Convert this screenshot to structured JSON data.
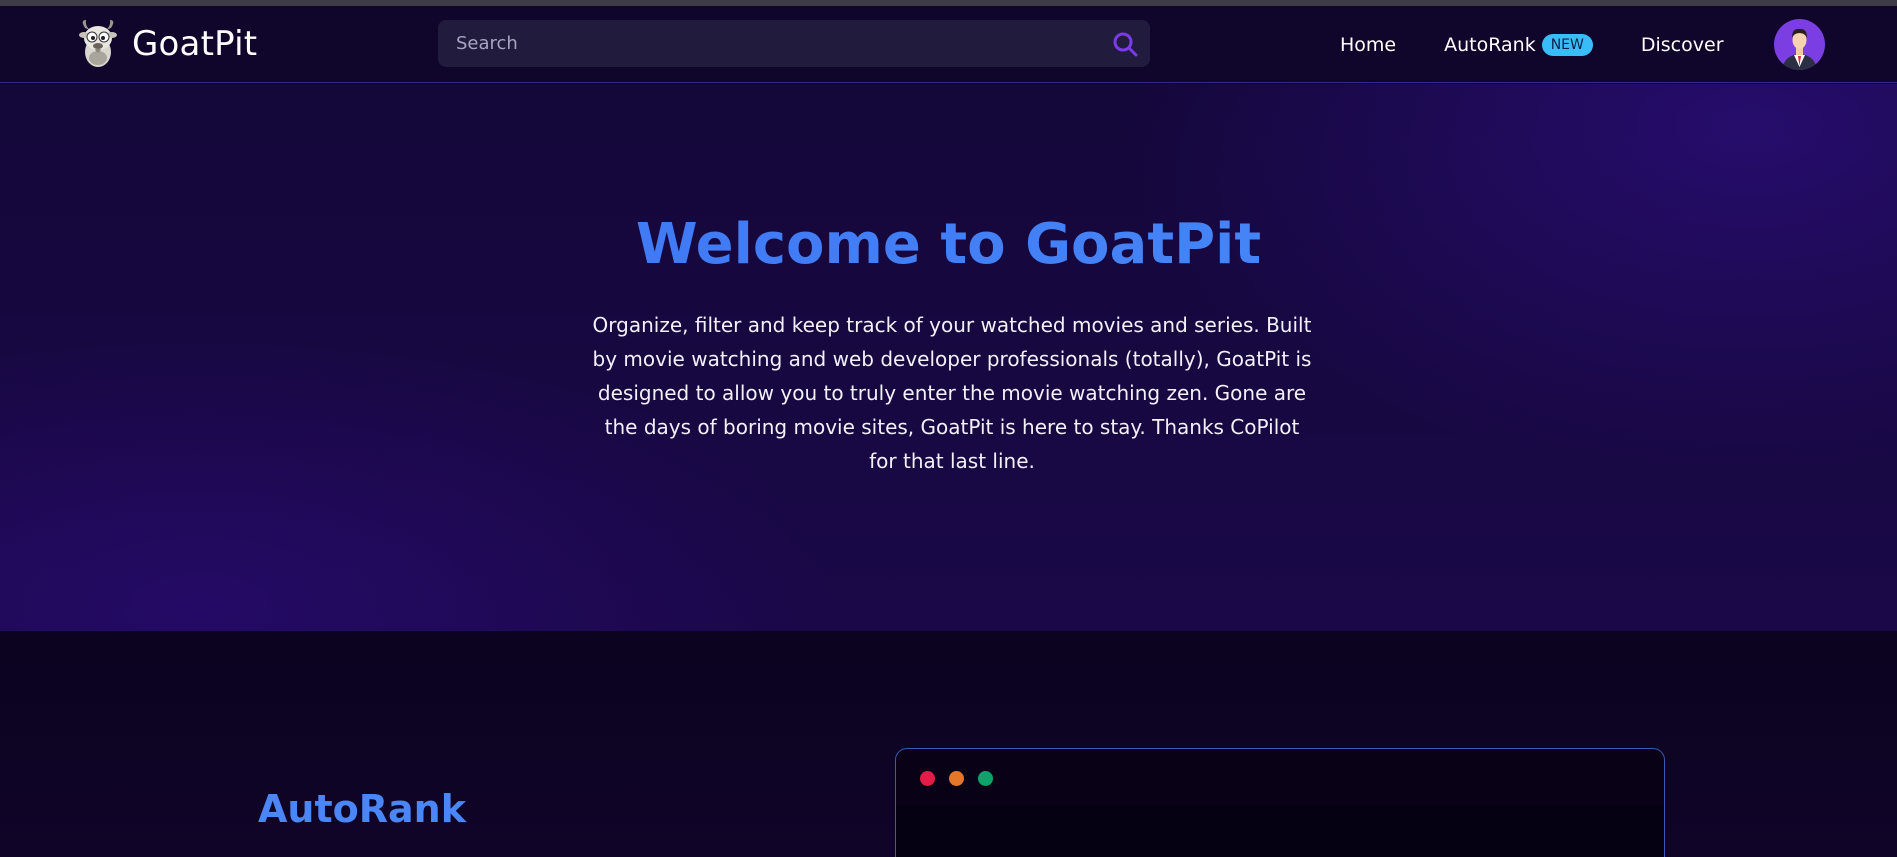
{
  "brand": {
    "name": "GoatPit",
    "logo_icon": "goat-logo-icon"
  },
  "search": {
    "placeholder": "Search",
    "icon": "search-icon"
  },
  "nav": {
    "home": "Home",
    "autorank": "AutoRank",
    "autorank_badge": "NEW",
    "discover": "Discover"
  },
  "user": {
    "avatar_icon": "user-avatar-icon"
  },
  "hero": {
    "title": "Welcome to GoatPit",
    "text": "Organize, filter and keep track of your watched movies and series. Built by movie watching and web developer professionals (totally), GoatPit is designed to allow you to truly enter the movie watching zen. Gone are the days of boring movie sites, GoatPit is here to stay. Thanks CoPilot for that last line."
  },
  "autorank_section": {
    "title": "AutoRank",
    "window_dots": [
      "red-dot",
      "orange-dot",
      "green-dot"
    ]
  },
  "colors": {
    "accent_blue": "#3b82f6",
    "badge_cyan": "#38bdf8",
    "navbar_bg": "#10052a",
    "hero_bg": "#160741",
    "search_icon": "#7c3aed"
  }
}
